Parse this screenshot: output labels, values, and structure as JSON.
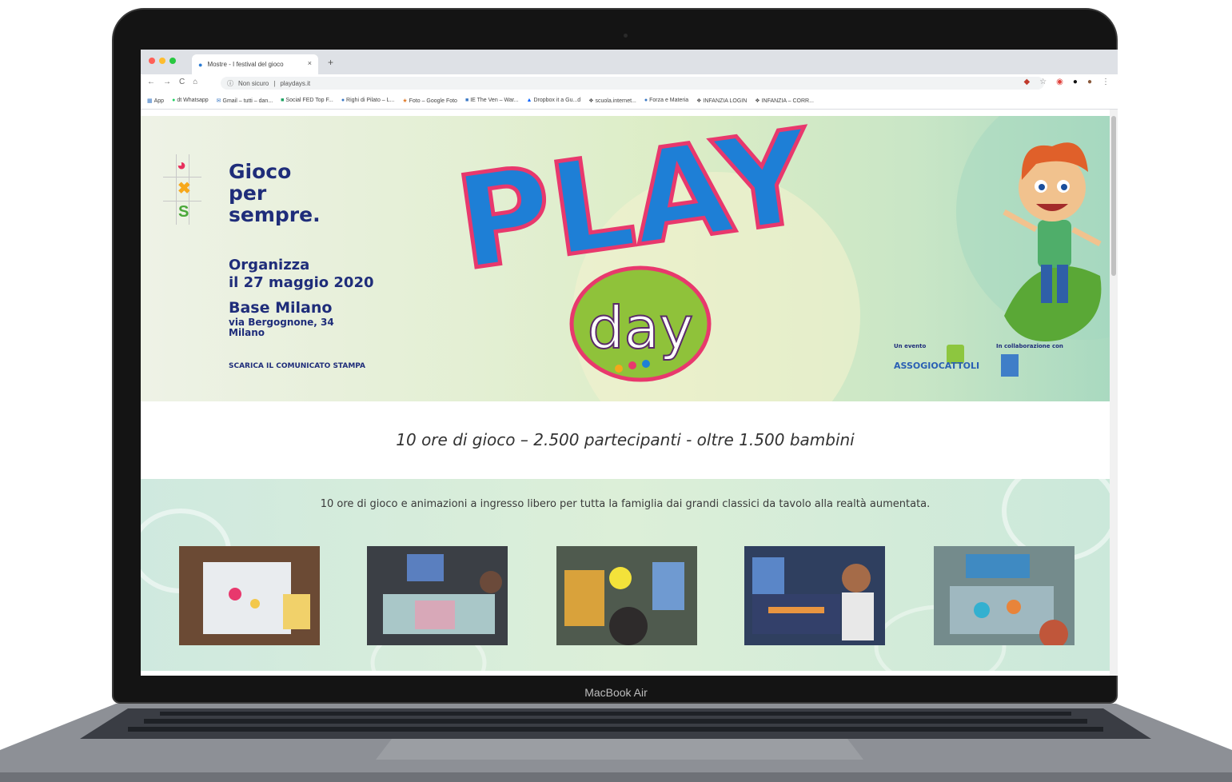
{
  "device": {
    "label": "MacBook Air"
  },
  "browser": {
    "tab_title": "Mostre - I festival del gioco",
    "new_tab": "+",
    "close_tab": "×",
    "url_security": "Non sicuro",
    "url": "playdays.it",
    "nav": {
      "back": "←",
      "forward": "→",
      "reload": "C",
      "home": "⌂"
    },
    "bookmarks": [
      "App",
      "dt Whatsapp",
      "Gmail – tutti – dan...",
      "Social FED Top F...",
      "Righi di Pilato – L...",
      "Foto – Google Foto",
      "IE The Ven – War...",
      "Dropbox it a Gu...d",
      "scuola.internet...",
      "Forza e Materia",
      "INFANZIA LOGIN",
      "INFANZIA – CORR..."
    ]
  },
  "hero": {
    "tagline": [
      "Gioco",
      "per",
      "sempre."
    ],
    "organizza": [
      "Organizza",
      "il 27 maggio 2020"
    ],
    "venue": "Base Milano",
    "address": [
      "via Bergognone, 34",
      "Milano"
    ],
    "press_link": "SCARICA IL COMUNICATO STAMPA",
    "logo_title": "PLAY",
    "logo_subtitle": "day",
    "partners": {
      "event_by_label": "Un evento",
      "event_by": "ASSOGIOCATTOLI",
      "collab_label": "In collaborazione con"
    }
  },
  "stats": "10 ore di gioco – 2.500 partecipanti - oltre 1.500 bambini",
  "gallery": {
    "description": "10 ore di gioco e animazioni a ingresso libero per tutta la famiglia dai grandi classici da tavolo alla realtà aumentata."
  },
  "colors": {
    "navy": "#1f2d7a",
    "play_blue": "#1e7fd6",
    "play_outline": "#e8386d",
    "day_green": "#8fc23a",
    "mint": "#cfe9df"
  }
}
